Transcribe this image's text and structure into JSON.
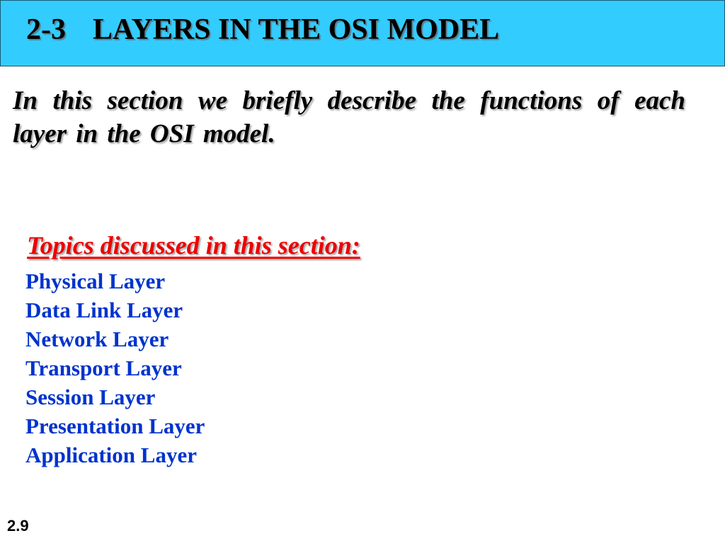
{
  "header": {
    "section_number": "2-3",
    "title": "LAYERS IN THE OSI MODEL",
    "background_color": "#33ccff"
  },
  "intro": {
    "text": "In this section we briefly describe the functions of each layer in the OSI model."
  },
  "topics": {
    "heading": "Topics discussed in this section:",
    "heading_color": "#ee0000",
    "item_color": "#0033cc",
    "items": [
      "Physical Layer",
      "Data Link Layer",
      "Network Layer",
      "Transport Layer",
      "Session Layer",
      "Presentation Layer",
      "Application Layer"
    ]
  },
  "footer": {
    "slide_number": "2.9"
  }
}
